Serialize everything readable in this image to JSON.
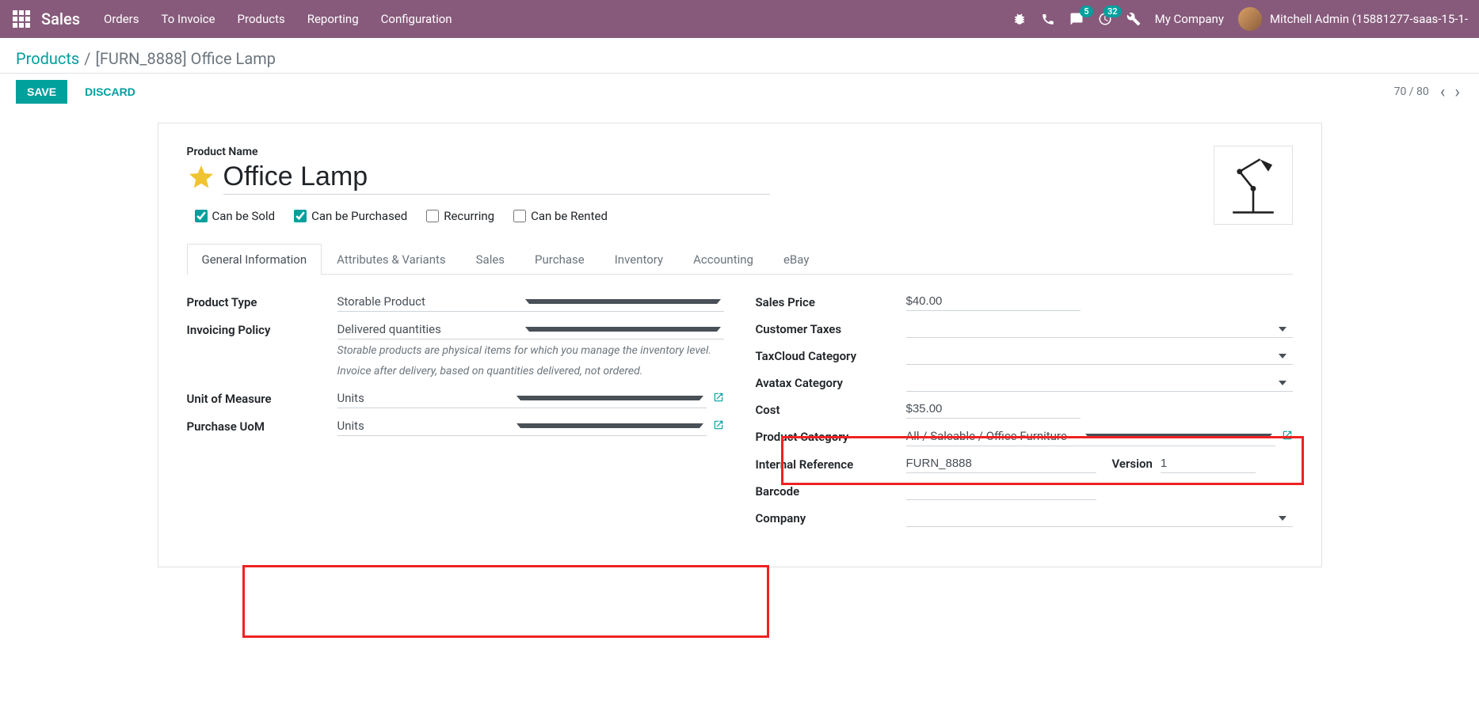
{
  "topbar": {
    "brand": "Sales",
    "menu": [
      "Orders",
      "To Invoice",
      "Products",
      "Reporting",
      "Configuration"
    ],
    "badge_messages": "5",
    "badge_activities": "32",
    "company": "My Company",
    "user": "Mitchell Admin (15881277-saas-15-1-"
  },
  "breadcrumb": {
    "parent": "Products",
    "current": "[FURN_8888] Office Lamp"
  },
  "actions": {
    "save": "SAVE",
    "discard": "DISCARD",
    "pager": "70 / 80"
  },
  "product": {
    "name_label": "Product Name",
    "name": "Office Lamp",
    "checks": {
      "sold": "Can be Sold",
      "purchased": "Can be Purchased",
      "recurring": "Recurring",
      "rented": "Can be Rented"
    }
  },
  "tabs": [
    "General Information",
    "Attributes & Variants",
    "Sales",
    "Purchase",
    "Inventory",
    "Accounting",
    "eBay"
  ],
  "left": {
    "product_type_lbl": "Product Type",
    "product_type": "Storable Product",
    "invoicing_lbl": "Invoicing Policy",
    "invoicing": "Delivered quantities",
    "help1": "Storable products are physical items for which you manage the inventory level.",
    "help2": "Invoice after delivery, based on quantities delivered, not ordered.",
    "uom_lbl": "Unit of Measure",
    "uom": "Units",
    "purchase_uom_lbl": "Purchase UoM",
    "purchase_uom": "Units"
  },
  "right": {
    "sales_price_lbl": "Sales Price",
    "sales_price": "$40.00",
    "customer_taxes_lbl": "Customer Taxes",
    "taxcloud_lbl": "TaxCloud Category",
    "avatax_lbl": "Avatax Category",
    "cost_lbl": "Cost",
    "cost": "$35.00",
    "category_lbl": "Product Category",
    "category": "All / Saleable / Office Furniture",
    "internal_ref_lbl": "Internal Reference",
    "internal_ref": "FURN_8888",
    "version_lbl": "Version",
    "version": "1",
    "barcode_lbl": "Barcode",
    "company_lbl": "Company"
  }
}
